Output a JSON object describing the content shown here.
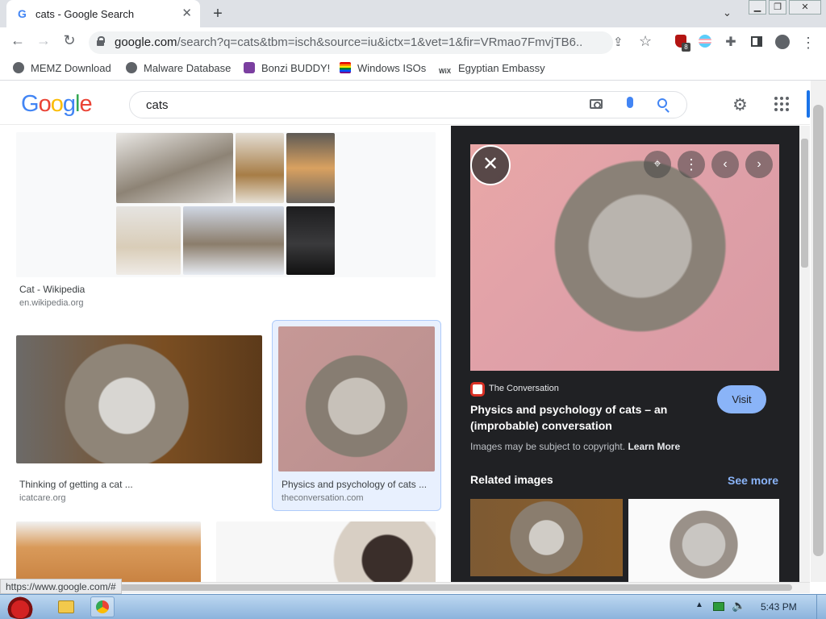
{
  "browser": {
    "tab": {
      "title": "cats - Google Search",
      "favicon": "G"
    },
    "new_tab_symbol": "+",
    "url_main": "google.com",
    "url_rest": "/search?q=cats&tbm=isch&source=iu&ictx=1&vet=1&fir=VRmao7FmvjTB6...",
    "extension_badge": "8"
  },
  "bookmarks": [
    {
      "label": "MEMZ Download"
    },
    {
      "label": "Malware Database"
    },
    {
      "label": "Bonzi BUDDY!"
    },
    {
      "label": "Windows ISOs"
    },
    {
      "label": "Egyptian Embassy"
    }
  ],
  "google": {
    "logo": [
      "G",
      "o",
      "o",
      "g",
      "l",
      "e"
    ],
    "logo_colors": [
      "#4285f4",
      "#ea4335",
      "#fbbc05",
      "#4285f4",
      "#34a853",
      "#ea4335"
    ],
    "query": "cats"
  },
  "results": [
    {
      "title": "Cat - Wikipedia",
      "source": "en.wikipedia.org"
    },
    {
      "title": "Thinking of getting a cat ...",
      "source": "icatcare.org"
    },
    {
      "title": "Physics and psychology of cats ...",
      "source": "theconversation.com"
    }
  ],
  "panel": {
    "source_name": "The Conversation",
    "title": "Physics and psychology of cats – an (improbable) conversation",
    "visit_label": "Visit",
    "copyright_text": "Images may be subject to copyright.",
    "learn_more": "Learn More",
    "related_heading": "Related images",
    "see_more": "See more"
  },
  "status_url": "https://www.google.com/#",
  "taskbar": {
    "time": "5:43 PM"
  }
}
